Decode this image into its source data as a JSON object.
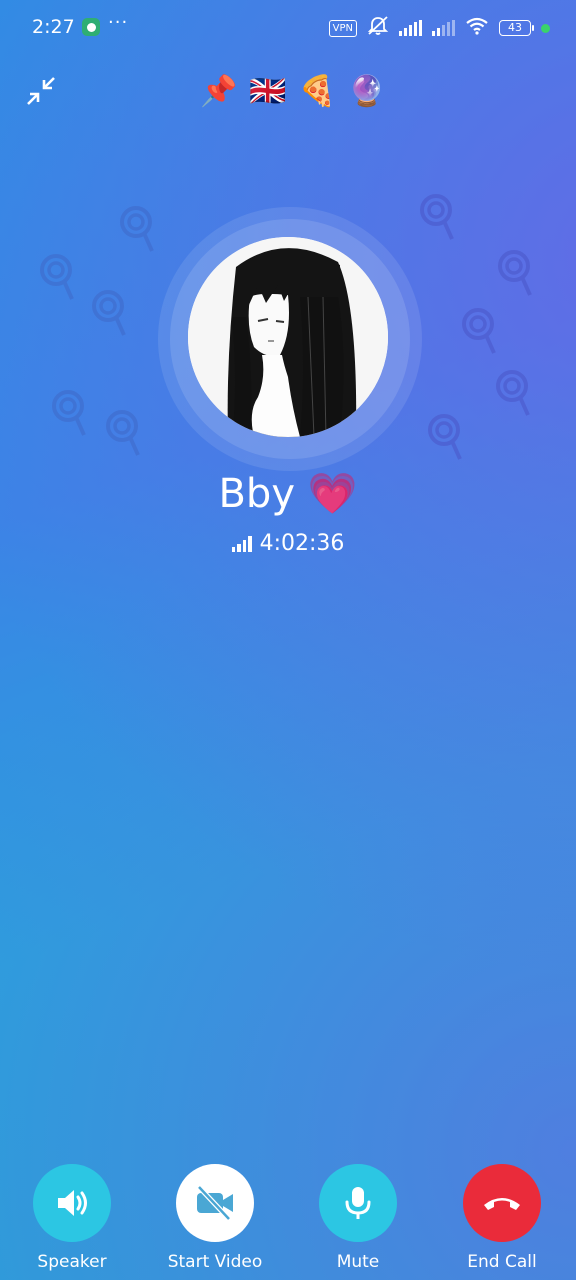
{
  "status_bar": {
    "time": "2:27",
    "more": "···",
    "vpn": "VPN",
    "battery": "43"
  },
  "top": {
    "emojis": [
      "📌",
      "🇬🇧",
      "🍕",
      "🔮"
    ]
  },
  "caller": {
    "name": "Bby 💗",
    "duration": "4:02:36"
  },
  "controls": {
    "speaker": "Speaker",
    "start_video": "Start Video",
    "mute": "Mute",
    "end_call": "End Call"
  },
  "colors": {
    "teal_button": "#2cc6e3",
    "end_call_red": "#ea2b3a",
    "video_icon_muted": "#4aa7d4"
  }
}
